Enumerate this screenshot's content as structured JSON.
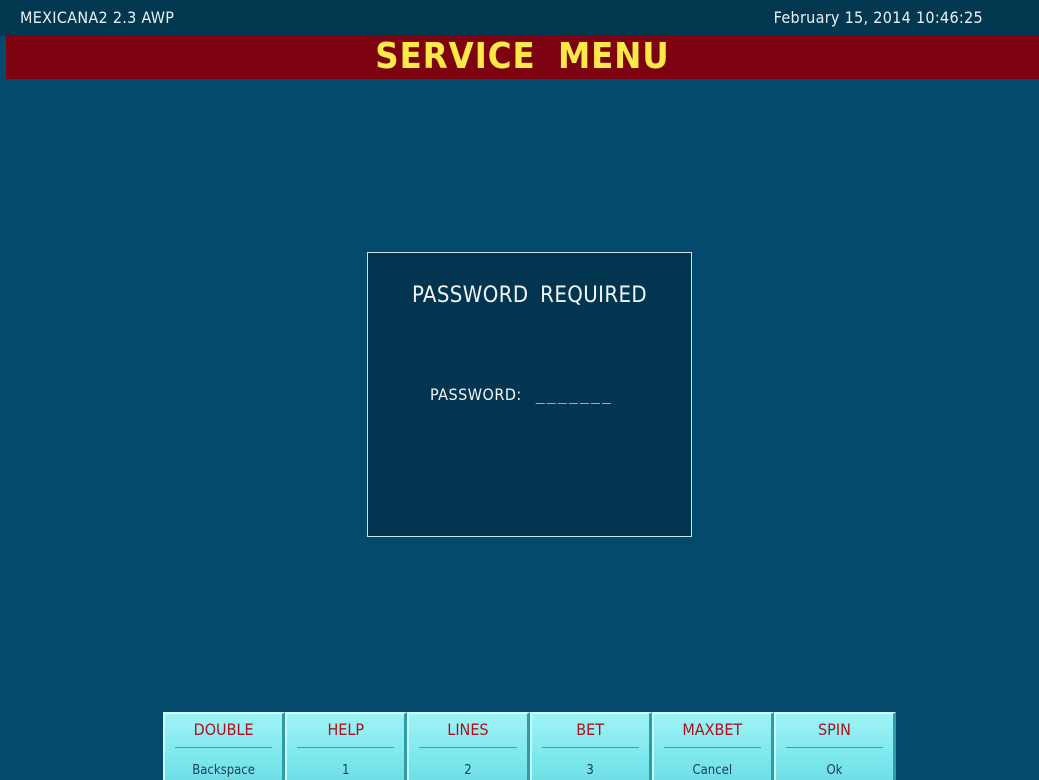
{
  "header": {
    "app_info": "MEXICANA2  2.3  AWP",
    "datetime": "February  15,  2014  10:46:25"
  },
  "title": "SERVICE  MENU",
  "dialog": {
    "heading": "PASSWORD  REQUIRED",
    "password_label": "PASSWORD:",
    "password_value": "_______"
  },
  "buttons": [
    {
      "label": "DOUBLE",
      "sub": "Backspace"
    },
    {
      "label": "HELP",
      "sub": "1"
    },
    {
      "label": "LINES",
      "sub": "2"
    },
    {
      "label": "BET",
      "sub": "3"
    },
    {
      "label": "MAXBET",
      "sub": "Cancel"
    },
    {
      "label": "SPIN",
      "sub": "Ok"
    }
  ],
  "colors": {
    "background": "#044a6d",
    "title_bar": "#7e0310",
    "title_text": "#ffe94a",
    "button": "#7fe9ee",
    "button_label": "#b0101e"
  }
}
